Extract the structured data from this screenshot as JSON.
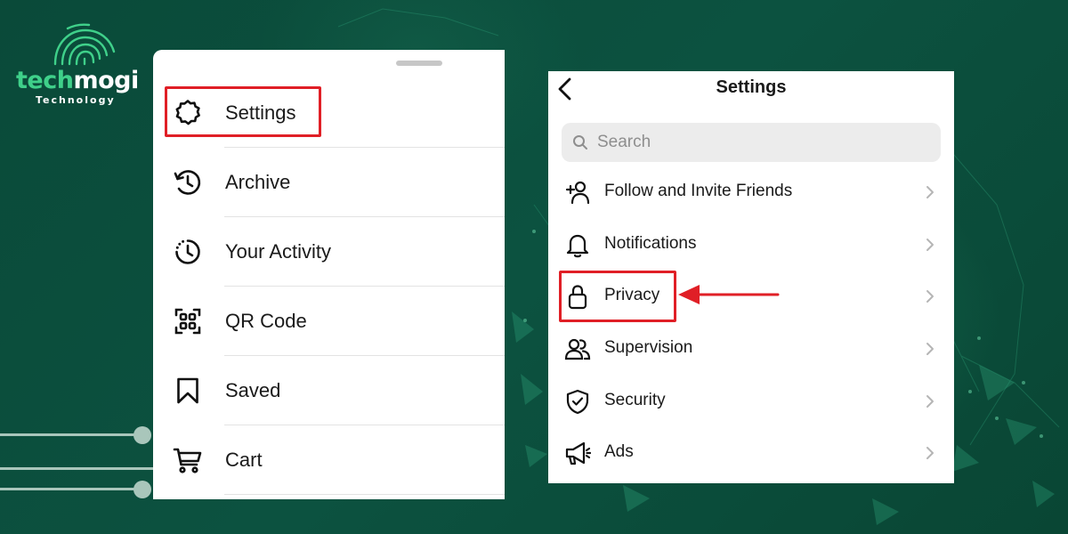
{
  "brand": {
    "word_part1": "tech",
    "word_part2": "mogi",
    "subtitle": "Technology"
  },
  "colors": {
    "background": "#0b4d3b",
    "brand_green": "#3fd08a",
    "highlight_red": "#e01f26",
    "text": "#1a1a1a",
    "chevron": "#b5b5b5"
  },
  "menu": {
    "items": [
      {
        "label": "Settings",
        "icon": "gear-icon"
      },
      {
        "label": "Archive",
        "icon": "archive-clock-icon"
      },
      {
        "label": "Your Activity",
        "icon": "activity-clock-icon"
      },
      {
        "label": "QR Code",
        "icon": "qr-code-icon"
      },
      {
        "label": "Saved",
        "icon": "bookmark-icon"
      },
      {
        "label": "Cart",
        "icon": "cart-icon"
      }
    ],
    "highlighted_item": "Settings"
  },
  "settings": {
    "title": "Settings",
    "search_placeholder": "Search",
    "rows": [
      {
        "label": "Follow and Invite Friends",
        "icon": "add-person-icon"
      },
      {
        "label": "Notifications",
        "icon": "bell-icon"
      },
      {
        "label": "Privacy",
        "icon": "lock-icon"
      },
      {
        "label": "Supervision",
        "icon": "people-icon"
      },
      {
        "label": "Security",
        "icon": "shield-check-icon"
      },
      {
        "label": "Ads",
        "icon": "megaphone-icon"
      }
    ],
    "highlighted_row": "Privacy"
  }
}
